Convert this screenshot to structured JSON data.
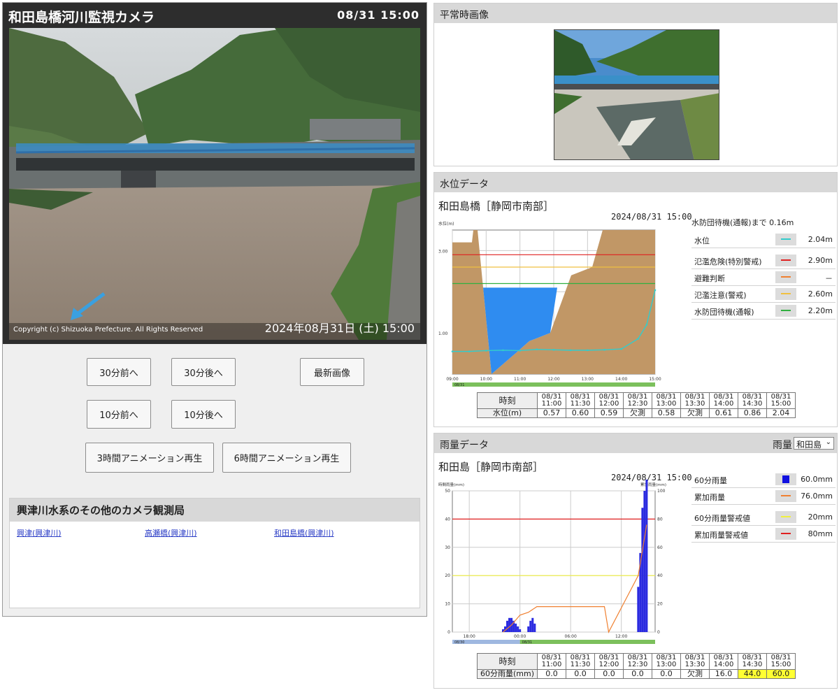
{
  "camera": {
    "title": "和田島橋河川監視カメラ",
    "header_time": "08/31 15:00",
    "copyright": "Copyright (c) Shizuoka Prefecture. All Rights Reserved",
    "timestamp": "2024年08月31日 (土) 15:00"
  },
  "buttons": {
    "back30": "30分前へ",
    "fwd30": "30分後へ",
    "latest": "最新画像",
    "back10": "10分前へ",
    "fwd10": "10分後へ",
    "anim3h": "3時間アニメーション再生",
    "anim6h": "6時間アニメーション再生"
  },
  "other_cameras": {
    "title": "興津川水系のその他のカメラ観測局",
    "links": [
      "興津(興津川)",
      "高瀬橋(興津川)",
      "和田島橋(興津川)"
    ]
  },
  "normal_image": {
    "title": "平常時画像"
  },
  "water_level": {
    "section_title": "水位データ",
    "station": "和田島橋［静岡市南部］",
    "datetime": "2024/08/31 15:00",
    "alert_note": "水防団待機(通報)まで 0.16m",
    "legend": [
      {
        "label": "水位",
        "value": "2.04m",
        "color": "#33cccc"
      },
      {
        "label": "氾濫危険(特別警戒)",
        "value": "2.90m",
        "color": "#e02020"
      },
      {
        "label": "避難判断",
        "value": "－",
        "color": "#f08030"
      },
      {
        "label": "氾濫注意(警戒)",
        "value": "2.60m",
        "color": "#f0c040"
      },
      {
        "label": "水防団待機(通報)",
        "value": "2.20m",
        "color": "#30b040"
      }
    ],
    "table": {
      "time_header": "時刻",
      "value_header": "水位(m)",
      "times": [
        [
          "08/31",
          "11:00"
        ],
        [
          "08/31",
          "11:30"
        ],
        [
          "08/31",
          "12:00"
        ],
        [
          "08/31",
          "12:30"
        ],
        [
          "08/31",
          "13:00"
        ],
        [
          "08/31",
          "13:30"
        ],
        [
          "08/31",
          "14:00"
        ],
        [
          "08/31",
          "14:30"
        ],
        [
          "08/31",
          "15:00"
        ]
      ],
      "values": [
        "0.57",
        "0.60",
        "0.59",
        "欠測",
        "0.58",
        "欠測",
        "0.61",
        "0.86",
        "2.04"
      ]
    }
  },
  "rainfall": {
    "section_title": "雨量データ",
    "select_label": "雨量",
    "select_value": "和田島",
    "station": "和田島［静岡市南部］",
    "datetime": "2024/08/31 15:00",
    "legend": [
      {
        "label": "60分雨量",
        "value": "60.0mm",
        "color": "#1010e0"
      },
      {
        "label": "累加雨量",
        "value": "76.0mm",
        "color": "#f08030"
      },
      {
        "label": "60分雨量警戒値",
        "value": "20mm",
        "color": "#f0f040"
      },
      {
        "label": "累加雨量警戒値",
        "value": "80mm",
        "color": "#e02020"
      }
    ],
    "table": {
      "time_header": "時刻",
      "value_header": "60分雨量(mm)",
      "times": [
        [
          "08/31",
          "11:00"
        ],
        [
          "08/31",
          "11:30"
        ],
        [
          "08/31",
          "12:00"
        ],
        [
          "08/31",
          "12:30"
        ],
        [
          "08/31",
          "13:00"
        ],
        [
          "08/31",
          "13:30"
        ],
        [
          "08/31",
          "14:00"
        ],
        [
          "08/31",
          "14:30"
        ],
        [
          "08/31",
          "15:00"
        ]
      ],
      "values": [
        "0.0",
        "0.0",
        "0.0",
        "0.0",
        "0.0",
        "欠測",
        "16.0",
        "44.0",
        "60.0"
      ],
      "highlight": [
        false,
        false,
        false,
        false,
        false,
        false,
        false,
        true,
        true
      ]
    }
  },
  "chart_data": [
    {
      "type": "area",
      "title": "",
      "ylabel": "水位(m)",
      "x_ticks": [
        "09:00",
        "10:00",
        "11:00",
        "12:00",
        "13:00",
        "14:00",
        "15:00"
      ],
      "y_ticks": [
        "1.00",
        "3.00"
      ],
      "ylim": [
        0.0,
        3.5
      ],
      "date_label": "08/31",
      "water_level_series": {
        "x": [
          "09:00",
          "09:30",
          "10:00",
          "10:30",
          "11:00",
          "11:30",
          "12:00",
          "12:30",
          "13:00",
          "13:30",
          "14:00",
          "14:30",
          "14:45",
          "15:00"
        ],
        "y": [
          0.55,
          0.55,
          0.57,
          0.58,
          0.57,
          0.6,
          0.59,
          0.58,
          0.58,
          0.59,
          0.61,
          0.86,
          1.2,
          2.04
        ]
      },
      "thresholds": [
        {
          "name": "氾濫危険(特別警戒)",
          "value": 2.9,
          "color": "#e02020"
        },
        {
          "name": "氾濫注意(警戒)",
          "value": 2.6,
          "color": "#f0c040"
        },
        {
          "name": "水防団待機(通報)",
          "value": 2.2,
          "color": "#30b040"
        }
      ]
    },
    {
      "type": "bar",
      "title": "",
      "ylabel_left": "時間雨量(mm)",
      "ylabel_right": "累加雨量(mm)",
      "x_ticks": [
        "18:00",
        "00:00",
        "06:00",
        "12:00"
      ],
      "y_left": [
        0,
        10,
        20,
        30,
        40,
        50
      ],
      "y_right": [
        0,
        20,
        40,
        60,
        80,
        100
      ],
      "date_labels": [
        "08/30",
        "08/31"
      ],
      "hourly_rain_series": {
        "x": [
          "22:00",
          "22:15",
          "22:30",
          "22:45",
          "23:00",
          "23:15",
          "23:30",
          "23:45",
          "00:00",
          "01:00",
          "01:15",
          "01:30",
          "01:45",
          "14:00",
          "14:15",
          "14:30",
          "14:45",
          "15:00"
        ],
        "y": [
          1,
          2,
          4,
          5,
          5,
          4,
          3,
          2,
          1,
          2,
          4,
          5,
          3,
          16,
          28,
          44,
          50,
          60
        ]
      },
      "cumulative_series": {
        "x": [
          "22:00",
          "23:00",
          "00:00",
          "01:00",
          "02:00",
          "09:00",
          "10:00",
          "10:30",
          "14:00",
          "15:00"
        ],
        "y": [
          0,
          5,
          12,
          14,
          18,
          18,
          18,
          0,
          40,
          76
        ]
      },
      "thresholds": [
        {
          "name": "60分雨量警戒値",
          "value": 20,
          "color": "#f0f040"
        },
        {
          "name": "累加雨量警戒値",
          "value": 80,
          "color": "#e02020"
        }
      ]
    }
  ]
}
